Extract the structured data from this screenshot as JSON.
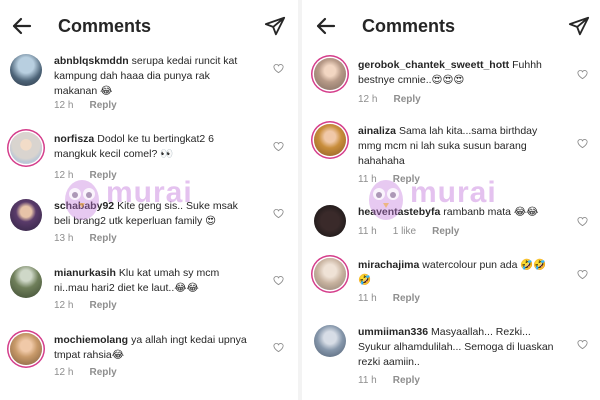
{
  "left": {
    "header": {
      "title": "Comments",
      "back_icon": "arrow-left-icon",
      "send_icon": "paper-plane-icon"
    },
    "comments": [
      {
        "username": "abnblqskmddn",
        "text": "serupa kedai runcit kat kampung dah haaa dia punya rak makanan 😂",
        "time": "12 h",
        "reply": "Reply",
        "likes": ""
      },
      {
        "username": "norfisza",
        "text": "Dodol ke tu bertingkat2 6 mangkuk kecil comel? 👀",
        "time": "12 h",
        "reply": "Reply",
        "likes": ""
      },
      {
        "username": "schababy92",
        "text": "Kite geng sis.. Suke msak beli brang2 utk keperluan family 😍",
        "time": "13 h",
        "reply": "Reply",
        "likes": ""
      },
      {
        "username": "mianurkasih",
        "text": "Klu kat umah sy mcm ni..mau hari2 diet ke laut..😂😂",
        "time": "12 h",
        "reply": "Reply",
        "likes": ""
      },
      {
        "username": "mochiemolang",
        "text": "ya allah ingt kedai upnya tmpat rahsia😂",
        "time": "12 h",
        "reply": "Reply",
        "likes": ""
      }
    ],
    "watermark": "murai"
  },
  "right": {
    "header": {
      "title": "Comments",
      "back_icon": "arrow-left-icon",
      "send_icon": "paper-plane-icon"
    },
    "comments": [
      {
        "username": "gerobok_chantek_sweett_hott",
        "text": "Fuhhh bestnye cmnie..😍😍😍",
        "time": "12 h",
        "reply": "Reply",
        "likes": ""
      },
      {
        "username": "ainaliza",
        "text": "Sama lah kita...sama birthday mmg mcm ni lah suka susun barang hahahaha",
        "time": "11 h",
        "reply": "Reply",
        "likes": ""
      },
      {
        "username": "heaventastebyfa",
        "text": "rambanb mata 😂😂",
        "time": "11 h",
        "reply": "Reply",
        "likes": "1 like"
      },
      {
        "username": "mirachajima",
        "text": "watercolour pun ada 🤣🤣🤣",
        "time": "11 h",
        "reply": "Reply",
        "likes": ""
      },
      {
        "username": "ummiiman336",
        "text": "Masyaallah... Rezki... Syukur alhamdulilah... Semoga di luaskan rezki aamiin..",
        "time": "11 h",
        "reply": "Reply",
        "likes": ""
      }
    ],
    "watermark": "murai"
  },
  "colors": {
    "story_ring": "#d43c8a",
    "meta_text": "#8e8e8e",
    "watermark": "#c478dc"
  }
}
